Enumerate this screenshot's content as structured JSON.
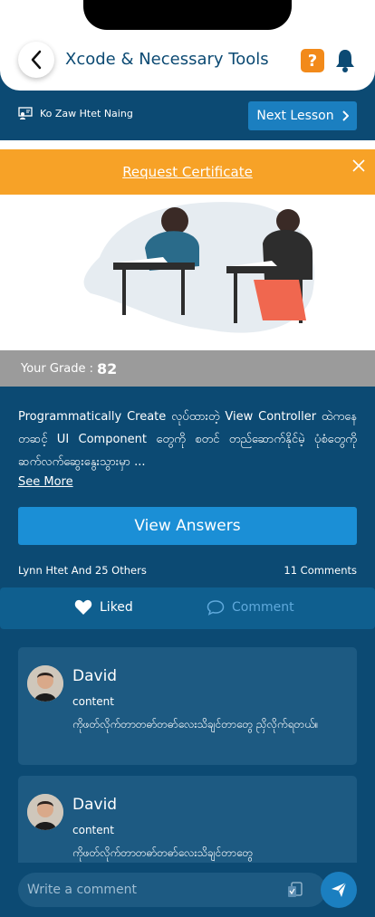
{
  "header": {
    "title": "Xcode & Necessary Tools",
    "help_label": "?"
  },
  "lesson": {
    "instructor": "Ko Zaw Htet Naing",
    "next_label": "Next Lesson"
  },
  "certificate": {
    "label": "Request Certificate"
  },
  "grade": {
    "label": "Your Grade : ",
    "value": "82"
  },
  "description": {
    "text": "Programmatically Create လုပ်ထားတဲ့ View Controller ထဲကနေ တဆင့် UI Component တွေကို စတင် တည်ဆောက်နိုင်မဲ့ ပုံစံတွေကို ဆက်လက်ဆွေးနွေးသွားမှာ ...",
    "see_more": "See  More"
  },
  "view_answers_label": "View Answers",
  "stats": {
    "likes": "Lynn Htet And 25 Others",
    "comments": "11 Comments"
  },
  "actions": {
    "liked": "Liked",
    "comment": "Comment"
  },
  "comments": [
    {
      "author": "David",
      "subtitle": "content",
      "text": "ကိုဖတ်လိုက်တာတဓာ်တဓာ်လေးသိချင်တာတွေ ညှိလိုက်ရတယ်။"
    },
    {
      "author": "David",
      "subtitle": "content",
      "text": "ကိုဖတ်လိုက်တာတဓာ်တဓာ်လေးသိချင်တာတွေ"
    }
  ],
  "composer": {
    "placeholder": "Write a comment"
  },
  "colors": {
    "primary": "#0c4a73",
    "accent": "#1b8fd6",
    "orange": "#f7a227"
  }
}
